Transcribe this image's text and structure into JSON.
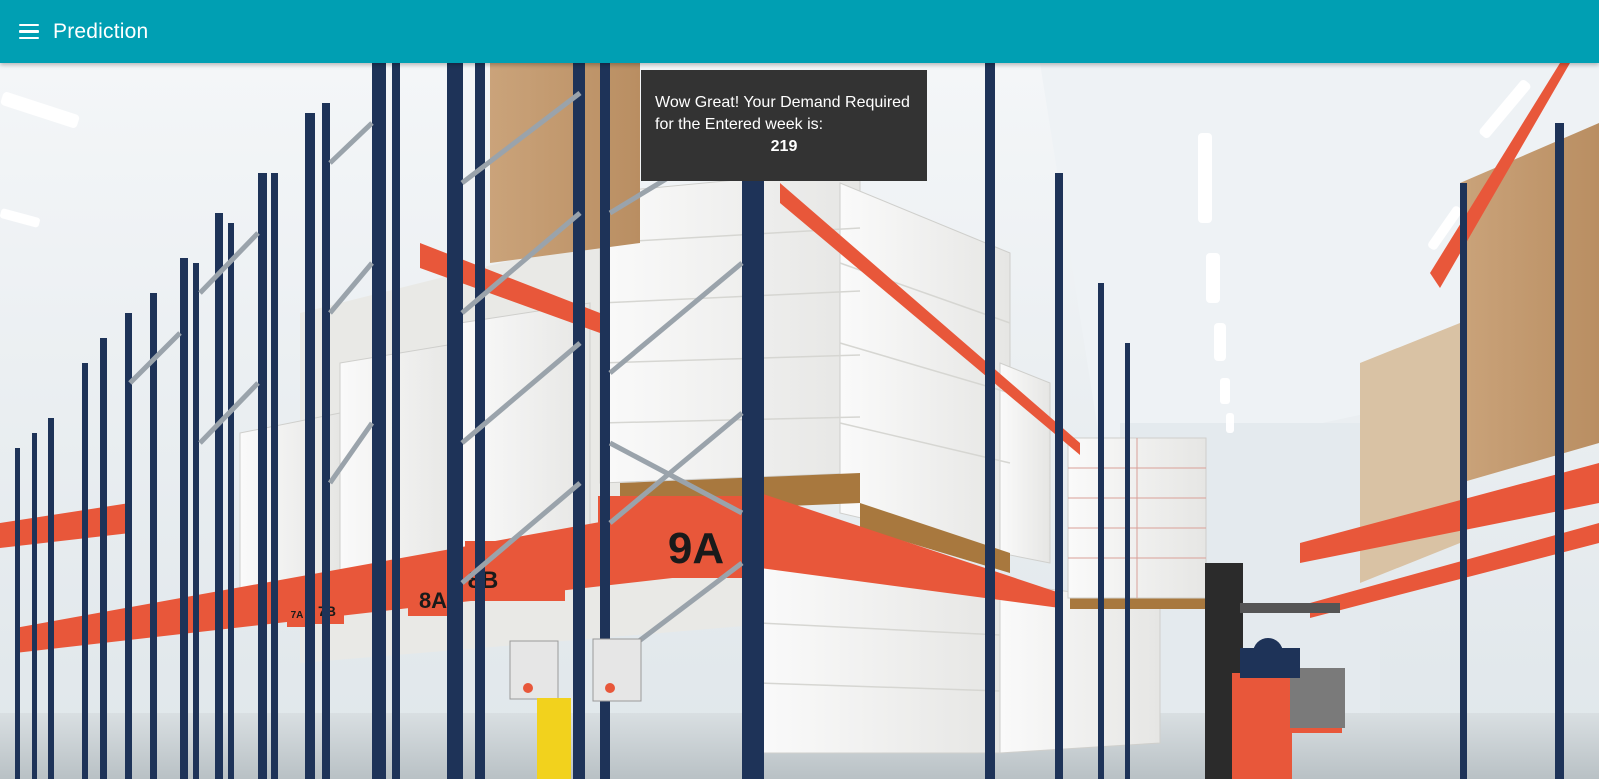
{
  "appbar": {
    "title": "Prediction",
    "menu_icon": "hamburger-menu-icon",
    "background_color": "#009fb3"
  },
  "result": {
    "message": "Wow Great! Your Demand Required for the Entered week is:",
    "value": "219"
  },
  "background": {
    "description_icon": "warehouse-image",
    "rack_labels": [
      "9A",
      "8B",
      "8A",
      "7B",
      "7A"
    ],
    "colors": {
      "rack_blue": "#1e3358",
      "rack_orange": "#e8573a",
      "boxes": "#f2f2f0"
    }
  }
}
